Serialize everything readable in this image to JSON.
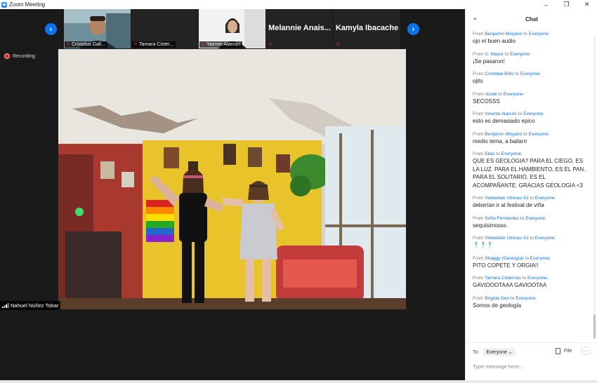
{
  "window": {
    "title": "Zoom Meeting",
    "controls": [
      "–",
      "❐",
      "✕"
    ]
  },
  "gallery": {
    "tiles": [
      {
        "name": "Cristobal Gall...",
        "muted": true,
        "video": true
      },
      {
        "name": "Tamara Cister...",
        "muted": true,
        "video": false
      },
      {
        "name": "Yazmin Alarcón",
        "muted": true,
        "video": true
      },
      {
        "name": "Melannie Anais...",
        "muted": true,
        "video": false
      },
      {
        "name": "Kamyla Ibacache",
        "muted": true,
        "video": false
      }
    ]
  },
  "recording": {
    "label": "Recording"
  },
  "active_speaker": {
    "name": "Nahuel Núñez Tobar"
  },
  "chat": {
    "title": "Chat",
    "messages": [
      {
        "prefix": "From",
        "sender": "Benjamín Moyano",
        "to_word": "to",
        "recipient": "Everyone:",
        "text": "ojo el buen audio"
      },
      {
        "prefix": "From",
        "sender": "U. Mayor",
        "to_word": "to",
        "recipient": "Everyone:",
        "text": "¡Se pasaron!"
      },
      {
        "prefix": "From",
        "sender": "Cristobal Brito",
        "to_word": "to",
        "recipient": "Everyone:",
        "text": "ojito"
      },
      {
        "prefix": "From",
        "sender": "nicole",
        "to_word": "to",
        "recipient": "Everyone:",
        "text": "SECOSSS"
      },
      {
        "prefix": "From",
        "sender": "Vicente Alarcón",
        "to_word": "to",
        "recipient": "Everyone:",
        "text": "esto es demasiado epico"
      },
      {
        "prefix": "From",
        "sender": "Benjamín Moyano",
        "to_word": "to",
        "recipient": "Everyone:",
        "text": "medio tema, a bailarrr"
      },
      {
        "prefix": "From",
        "sender": "Elias",
        "to_word": "to",
        "recipient": "Everyone:",
        "text": "QUE ES GEOLOGIA? PARA EL CIEGO, ES LA LUZ. PARA EL HAMBIENTO, ES EL PAN. PARA EL SOLITARIO, ES EL ACOMPAÑANTE. GRACIAS GEOLOGIA <3"
      },
      {
        "prefix": "From",
        "sender": "Sebastian Utreras SJ",
        "to_word": "to",
        "recipient": "Everyone:",
        "text": "deberían ir al festival de viña"
      },
      {
        "prefix": "From",
        "sender": "Sofía Fernández",
        "to_word": "to",
        "recipient": "Everyone:",
        "text": "sequisimosss"
      },
      {
        "prefix": "From",
        "sender": "Sebastian Utreras SJ",
        "to_word": "to",
        "recipient": "Everyone:",
        "text": "🕺🕺🕺"
      },
      {
        "prefix": "From",
        "sender": "Shaggy (Geología)",
        "to_word": "to",
        "recipient": "Everyone:",
        "text": "PITO COPETE Y ORGIA!!"
      },
      {
        "prefix": "From",
        "sender": "Tamara Cisternas",
        "to_word": "to",
        "recipient": "Everyone:",
        "text": "GAVIOOOTAAA GAVIOOTAA"
      },
      {
        "prefix": "From",
        "sender": "Brigida Geo",
        "to_word": "to",
        "recipient": "Everyone:",
        "text": "Somos de geología"
      }
    ],
    "to_label": "To:",
    "recipient_select": "Everyone",
    "file_label": "File",
    "more_label": "···",
    "input_placeholder": "Type message here..."
  }
}
